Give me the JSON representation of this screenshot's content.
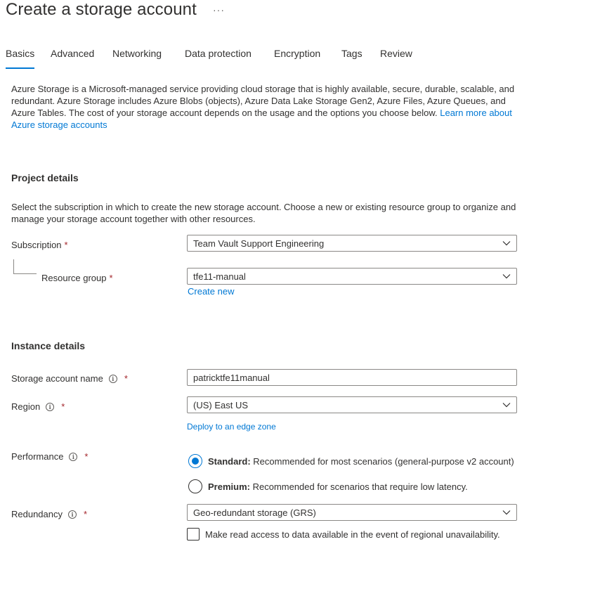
{
  "header": {
    "title": "Create a storage account",
    "more_label": "···"
  },
  "tabs": [
    {
      "label": "Basics",
      "active": true
    },
    {
      "label": "Advanced",
      "active": false
    },
    {
      "label": "Networking",
      "active": false
    },
    {
      "label": "Data protection",
      "active": false
    },
    {
      "label": "Encryption",
      "active": false
    },
    {
      "label": "Tags",
      "active": false
    },
    {
      "label": "Review",
      "active": false
    }
  ],
  "intro": {
    "text": "Azure Storage is a Microsoft-managed service providing cloud storage that is highly available, secure, durable, scalable, and redundant. Azure Storage includes Azure Blobs (objects), Azure Data Lake Storage Gen2, Azure Files, Azure Queues, and Azure Tables. The cost of your storage account depends on the usage and the options you choose below.",
    "link": "Learn more about Azure storage accounts"
  },
  "project": {
    "title": "Project details",
    "description": "Select the subscription in which to create the new storage account. Choose a new or existing resource group to organize and manage your storage account together with other resources.",
    "subscription_label": "Subscription",
    "subscription_value": "Team Vault Support Engineering",
    "resource_group_label": "Resource group",
    "resource_group_value": "tfe11-manual",
    "create_new": "Create new"
  },
  "instance": {
    "title": "Instance details",
    "name_label": "Storage account name",
    "name_value": "patricktfe11manual",
    "region_label": "Region",
    "region_value": "(US) East US",
    "edge_zone_link": "Deploy to an edge zone",
    "performance_label": "Performance",
    "performance_options": [
      {
        "title": "Standard:",
        "desc": "Recommended for most scenarios (general-purpose v2 account)",
        "selected": true
      },
      {
        "title": "Premium:",
        "desc": "Recommended for scenarios that require low latency.",
        "selected": false
      }
    ],
    "redundancy_label": "Redundancy",
    "redundancy_value": "Geo-redundant storage (GRS)",
    "read_access_label": "Make read access to data available in the event of regional unavailability.",
    "read_access_checked": false
  },
  "common": {
    "required_marker": "*",
    "info_glyph": "i"
  },
  "colors": {
    "accent": "#0078d4",
    "required": "#a4262c",
    "text": "#323130"
  }
}
